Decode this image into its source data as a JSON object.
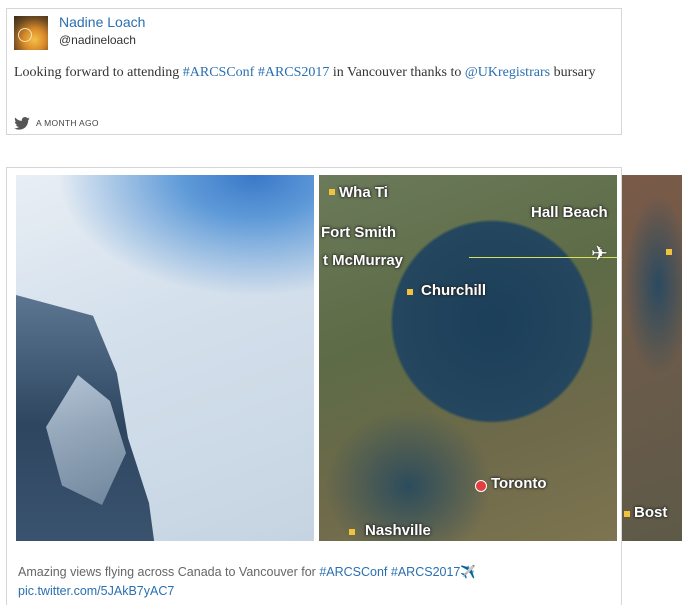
{
  "tweet1": {
    "name": "Nadine Loach",
    "handle": "@nadineloach",
    "text_before": "Looking forward to attending ",
    "hashtag1": "#ARCSConf",
    "hashtag2": "#ARCS2017",
    "text_middle": " in Vancouver thanks to ",
    "mention": "@UKregistrars",
    "text_after": " bursary",
    "timestamp": "A MONTH AGO",
    "icon": "twitter-bird-icon"
  },
  "tweet2": {
    "map_labels": {
      "wha_ti": "Wha Ti",
      "hall_beach": "Hall Beach",
      "fort_smith": "Fort Smith",
      "fort_mcmurray": "t McMurray",
      "churchill": "Churchill",
      "toronto": "Toronto",
      "nashville": "Nashville",
      "boston": "Bost"
    },
    "caption_text": "Amazing views flying across Canada to Vancouver for ",
    "hashtag1": "#ARCSConf",
    "hashtag2": "#ARCS2017",
    "emoji": "✈️",
    "pic_link": "pic.twitter.com/5JAkB7yAC7"
  },
  "colors": {
    "link": "#2a6fb0",
    "border": "#d6d6d6"
  }
}
